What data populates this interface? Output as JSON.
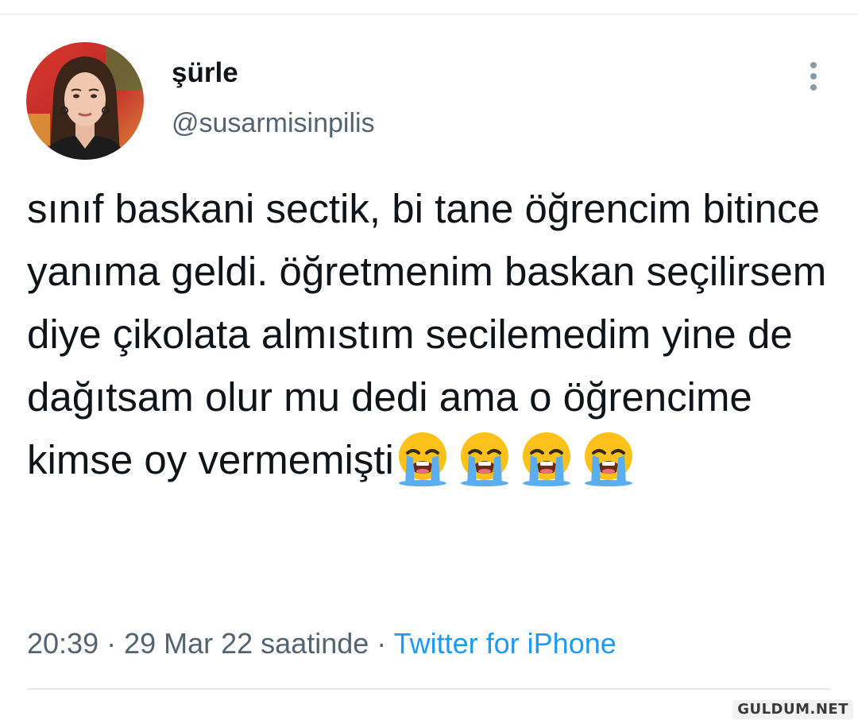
{
  "tweet": {
    "display_name": "şürle",
    "handle": "@susarmisinpilis",
    "text": "sınıf baskani sectik, bi tane öğrencim bitince yanıma geldi. öğretmenim baskan seçilirsem diye çikolata almıstım secilemedim yine de dağıtsam olur mu dedi ama o öğrencime kimse oy vermemişti",
    "emojis": [
      "loudly-crying-face",
      "loudly-crying-face",
      "loudly-crying-face",
      "loudly-crying-face"
    ],
    "time": "20:39",
    "separator": " · ",
    "date": "29 Mar 22 saatinde",
    "source": "Twitter for iPhone",
    "more_icon": "more-vertical-icon"
  },
  "watermark": "GULDUM.NET",
  "colors": {
    "text_primary": "#0f1419",
    "text_secondary": "#536471",
    "link": "#1d9bf0",
    "divider": "#e7eaec"
  }
}
